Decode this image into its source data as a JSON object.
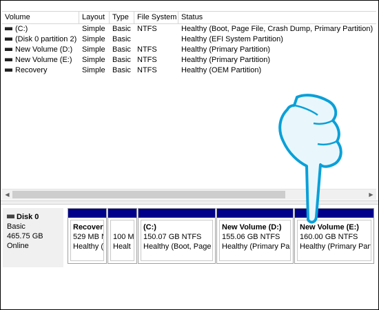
{
  "columns": {
    "volume": "Volume",
    "layout": "Layout",
    "type": "Type",
    "file_system": "File System",
    "status": "Status"
  },
  "volumes": [
    {
      "name": "(C:)",
      "layout": "Simple",
      "type": "Basic",
      "fs": "NTFS",
      "status": "Healthy (Boot, Page File, Crash Dump, Primary Partition)"
    },
    {
      "name": "(Disk 0 partition 2)",
      "layout": "Simple",
      "type": "Basic",
      "fs": "",
      "status": "Healthy (EFI System Partition)"
    },
    {
      "name": "New Volume (D:)",
      "layout": "Simple",
      "type": "Basic",
      "fs": "NTFS",
      "status": "Healthy (Primary Partition)"
    },
    {
      "name": "New Volume (E:)",
      "layout": "Simple",
      "type": "Basic",
      "fs": "NTFS",
      "status": "Healthy (Primary Partition)"
    },
    {
      "name": "Recovery",
      "layout": "Simple",
      "type": "Basic",
      "fs": "NTFS",
      "status": "Healthy (OEM Partition)"
    }
  ],
  "disk": {
    "name": "Disk 0",
    "type": "Basic",
    "size": "465.75 GB",
    "state": "Online"
  },
  "partitions": [
    {
      "name": "Recovery",
      "size": "529 MB N",
      "status": "Healthy ("
    },
    {
      "name": "",
      "size": "100 M",
      "status": "Healt"
    },
    {
      "name": "(C:)",
      "size": "150.07 GB NTFS",
      "status": "Healthy (Boot, Page"
    },
    {
      "name": "New Volume  (D:)",
      "size": "155.06 GB NTFS",
      "status": "Healthy (Primary Par"
    },
    {
      "name": "New Volume  (E:)",
      "size": "160.00 GB NTFS",
      "status": "Healthy (Primary Part"
    }
  ],
  "icons": {
    "volume": "drive-icon",
    "disk": "disk-icon",
    "pointer": "pointing-hand-icon"
  },
  "colors": {
    "partition_bar": "#00008b",
    "pointer_fill": "#e9f7fc",
    "pointer_outline": "#0aa0d8"
  }
}
